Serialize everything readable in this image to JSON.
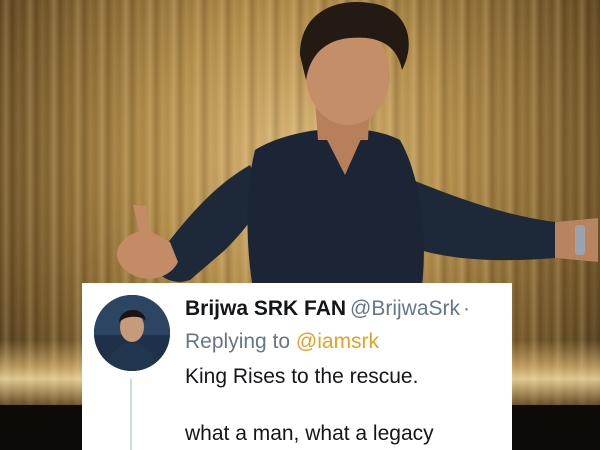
{
  "tweet": {
    "display_name": "Brijwa SRK FAN",
    "handle": "@BrijwaSrk",
    "separator": "·",
    "reply_prefix": "Replying to",
    "reply_mention": "@iamsrk",
    "text_line1": "King Rises to the rescue.",
    "text_line2": "what a man, what a legacy"
  },
  "colors": {
    "mention": "#e0a229",
    "secondary_text": "#657786",
    "primary_text": "#14171a"
  }
}
